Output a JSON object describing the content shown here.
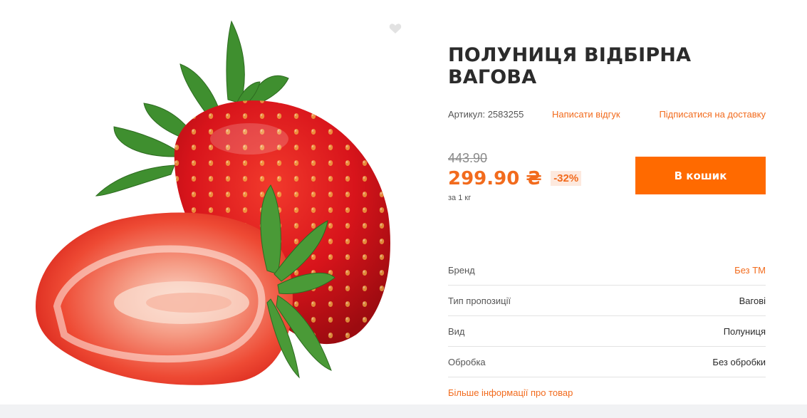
{
  "product": {
    "title": "ПОЛУНИЦЯ ВІДБІРНА ВАГОВА",
    "sku_text": "Артикул: 2583255",
    "review_link": "Написати відгук",
    "subscribe_link": "Підписатися на доставку",
    "old_price": "443.90",
    "price": "299.90 ₴",
    "discount": "-32%",
    "unit": "за 1 кг",
    "cart_button": "В кошик"
  },
  "specs": [
    {
      "label": "Бренд",
      "value": "Без ТМ"
    },
    {
      "label": "Тип пропозиції",
      "value": "Вагові"
    },
    {
      "label": "Вид",
      "value": "Полуниця"
    },
    {
      "label": "Обробка",
      "value": "Без обробки"
    }
  ],
  "more_info_link": "Більше інформації про товар",
  "colors": {
    "accent": "#ff6a00",
    "link": "#f26b1d",
    "discount_bg": "#fde9de"
  },
  "icons": {
    "favorite": "heart-icon"
  }
}
